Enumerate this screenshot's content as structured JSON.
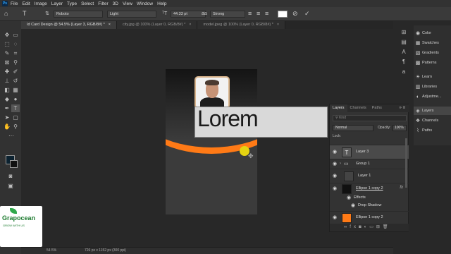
{
  "menubar": {
    "logo": "Ps",
    "items": [
      "File",
      "Edit",
      "Image",
      "Layer",
      "Type",
      "Select",
      "Filter",
      "3D",
      "View",
      "Window",
      "Help"
    ]
  },
  "options": {
    "font_family": "Roboto",
    "font_style": "Light",
    "font_size": "44.33 pt",
    "anti_alias": "Strong"
  },
  "tabs": [
    {
      "label": "Id Card Design @ 54.5% (Layer 3, RGB/8#) *",
      "active": true
    },
    {
      "label": "city.jpg @ 100% (Layer 0, RGB/8#) *",
      "active": false
    },
    {
      "label": "model.jpeg @ 100% (Layer 0, RGB/8#) *",
      "active": false
    }
  ],
  "canvas": {
    "text": "Lorem"
  },
  "status": {
    "zoom": "54.5%",
    "doc_info": "726 px x 1152 px (300 ppi)"
  },
  "right_panel": [
    {
      "label": "Color",
      "icon": "color-wheel-icon"
    },
    {
      "label": "Swatches",
      "icon": "grid-icon"
    },
    {
      "label": "Gradients",
      "icon": "gradient-icon"
    },
    {
      "label": "Patterns",
      "icon": "pattern-icon"
    },
    {
      "label": "Learn",
      "icon": "lightbulb-icon"
    },
    {
      "label": "Libraries",
      "icon": "library-icon"
    },
    {
      "label": "Adjustme...",
      "icon": "adjust-icon"
    },
    {
      "label": "Layers",
      "icon": "layers-icon"
    },
    {
      "label": "Channels",
      "icon": "channels-icon"
    },
    {
      "label": "Paths",
      "icon": "paths-icon"
    }
  ],
  "layers_panel": {
    "tabs": [
      "Layers",
      "Channels",
      "Paths"
    ],
    "search_placeholder": "Kind",
    "blend_mode": "Normal",
    "opacity_label": "Opacity:",
    "opacity": "100%",
    "lock_label": "Lock:",
    "rows": [
      {
        "name": "Layer 3",
        "thumb": "T",
        "selected": true
      },
      {
        "name": "Group 1",
        "thumb": "▭",
        "selected": false
      },
      {
        "name": "Layer 1",
        "thumb": "",
        "selected": false
      },
      {
        "name": "Ellipse 1 copy 2",
        "thumb": "",
        "selected": false,
        "fx": "fx"
      },
      {
        "name": "Effects",
        "thumb": "",
        "selected": false
      },
      {
        "name": "Drop Shadow",
        "thumb": "",
        "selected": false
      },
      {
        "name": "Ellipse 1 copy 2",
        "thumb": "",
        "selected": false
      }
    ]
  },
  "watermark": {
    "brand": "Grapocean",
    "tagline": "GROW WITH US"
  },
  "colors": {
    "orange": "#ff7a16",
    "purple": "#8a45c8",
    "yellow": "#e5d311"
  }
}
